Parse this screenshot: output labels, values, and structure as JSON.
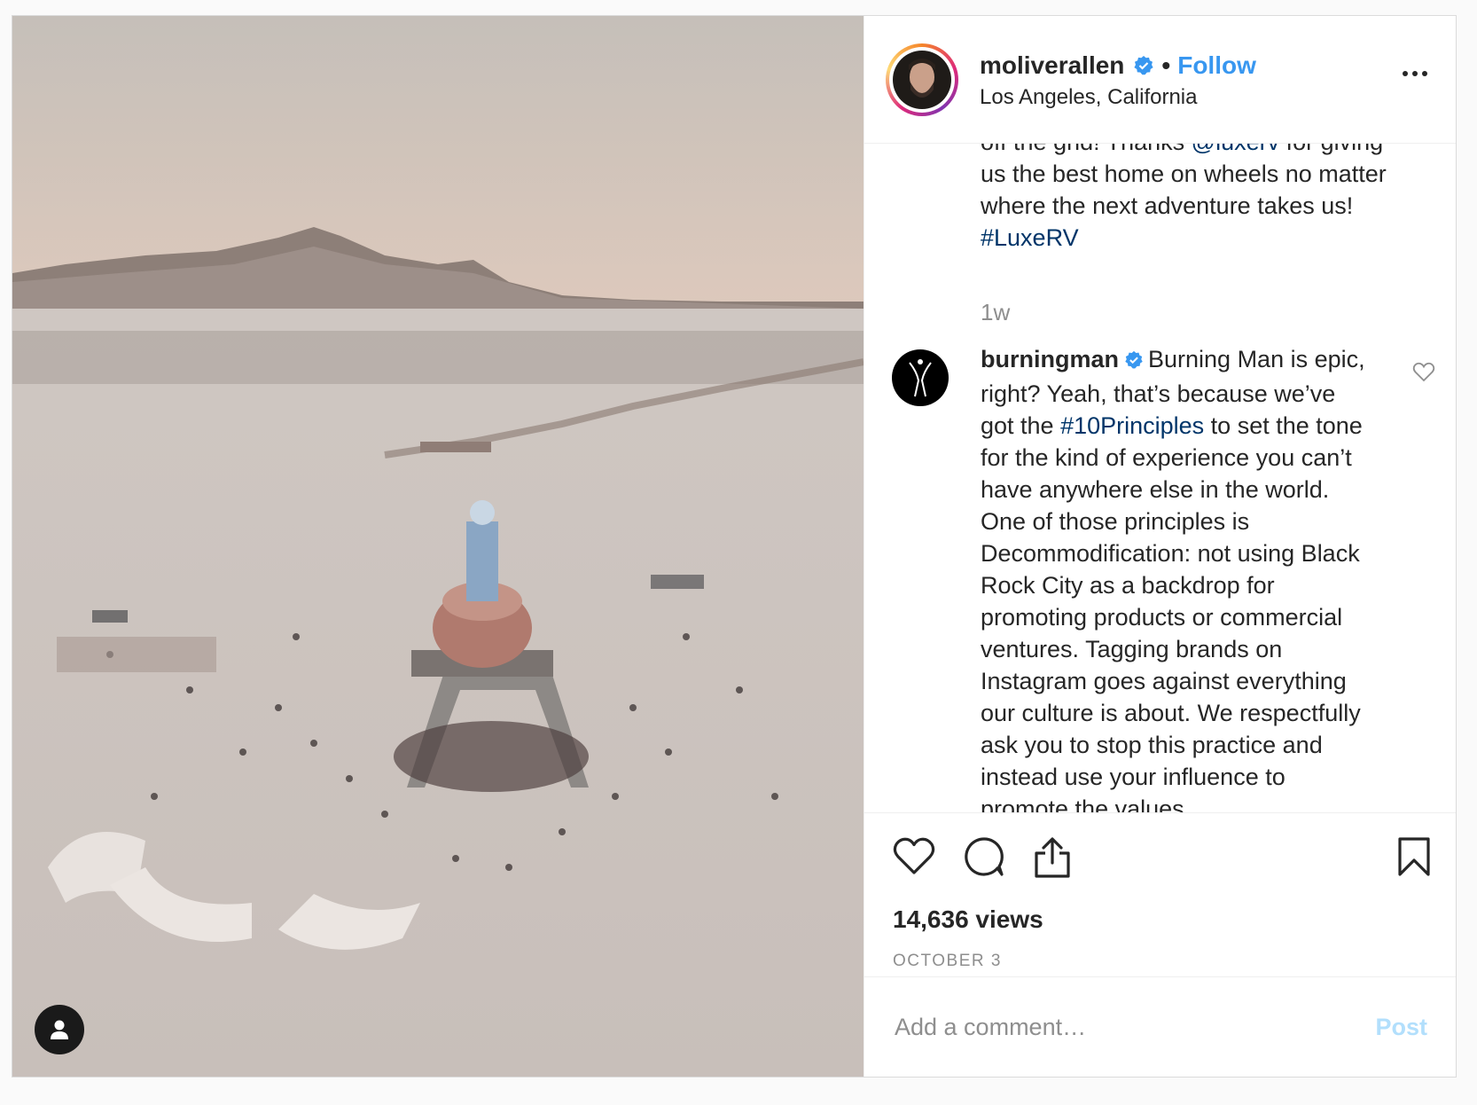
{
  "header": {
    "username": "moliverallen",
    "dot": "•",
    "follow_label": "Follow",
    "location": "Los Angeles, California",
    "verified_icon": "verified-badge-icon",
    "more_icon": "more-options-icon"
  },
  "caption": {
    "part1": "off the grid! Thanks ",
    "mention": "@luxerv",
    "part2": " for giving us the best home on wheels no matter where the next adventure takes us! ",
    "hashtag": "#LuxeRV"
  },
  "time_ago": "1w",
  "comment": {
    "username": "burningman",
    "text_before": "Burning Man is epic, right? Yeah, that’s because we’ve got the ",
    "hashtag": "#10Principles",
    "text_after": " to set the tone for the kind of experience you can’t have anywhere else in the world. One of those principles is Decommodification: not using Black Rock City as a backdrop for promoting products or commercial ventures. Tagging brands on Instagram goes against everything our culture is about. We respectfully ask you to stop this practice and instead use your influence to promote the values"
  },
  "stats": {
    "views": "14,636 views",
    "date": "OCTOBER 3"
  },
  "add_comment": {
    "placeholder": "Add a comment…",
    "post_label": "Post"
  },
  "colors": {
    "link": "#003569",
    "follow": "#3897f0",
    "post_disabled": "#b2dffc",
    "muted": "#8e8e8e"
  },
  "icons": [
    "heart-icon",
    "comment-icon",
    "share-icon",
    "bookmark-icon",
    "user-tag-icon"
  ]
}
